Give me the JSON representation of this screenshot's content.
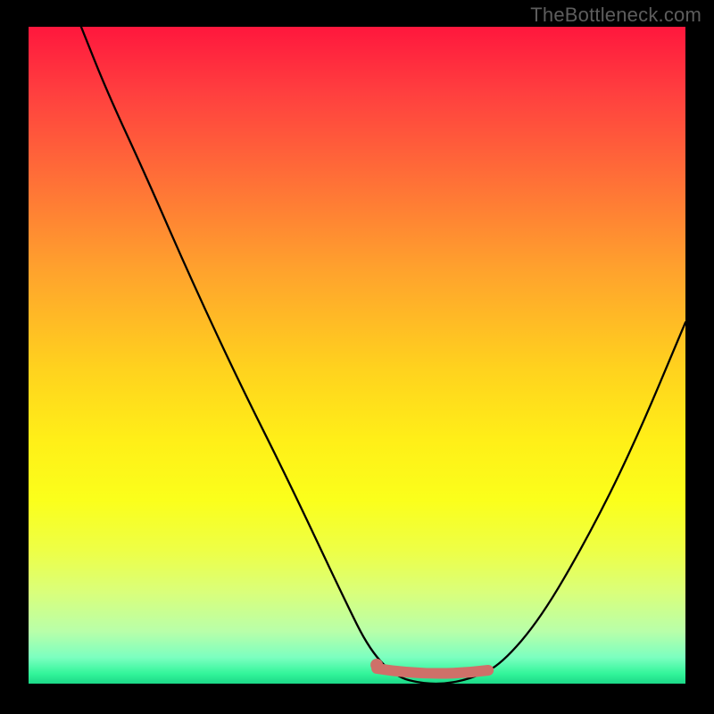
{
  "watermark": "TheBottleneck.com",
  "chart_data": {
    "type": "line",
    "title": "",
    "xlabel": "",
    "ylabel": "",
    "xlim": [
      0,
      100
    ],
    "ylim": [
      0,
      100
    ],
    "series": [
      {
        "name": "bottleneck-curve",
        "x": [
          8,
          12,
          18,
          25,
          32,
          40,
          48,
          52,
          56,
          60,
          64,
          68,
          72,
          78,
          85,
          92,
          100
        ],
        "values": [
          100,
          90,
          77,
          61,
          46,
          30,
          13,
          5,
          1,
          0,
          0,
          1,
          3,
          10,
          22,
          36,
          55
        ]
      }
    ],
    "highlight_band": {
      "name": "optimal-range",
      "x_start": 53,
      "x_end": 70,
      "y_approx": 1.5,
      "color": "#cf7069"
    },
    "colors": {
      "curve": "#000000",
      "highlight": "#cf7069",
      "gradient_top": "#ff173d",
      "gradient_bottom": "#1cd888",
      "background": "#000000",
      "watermark": "#5d5d5d"
    }
  }
}
